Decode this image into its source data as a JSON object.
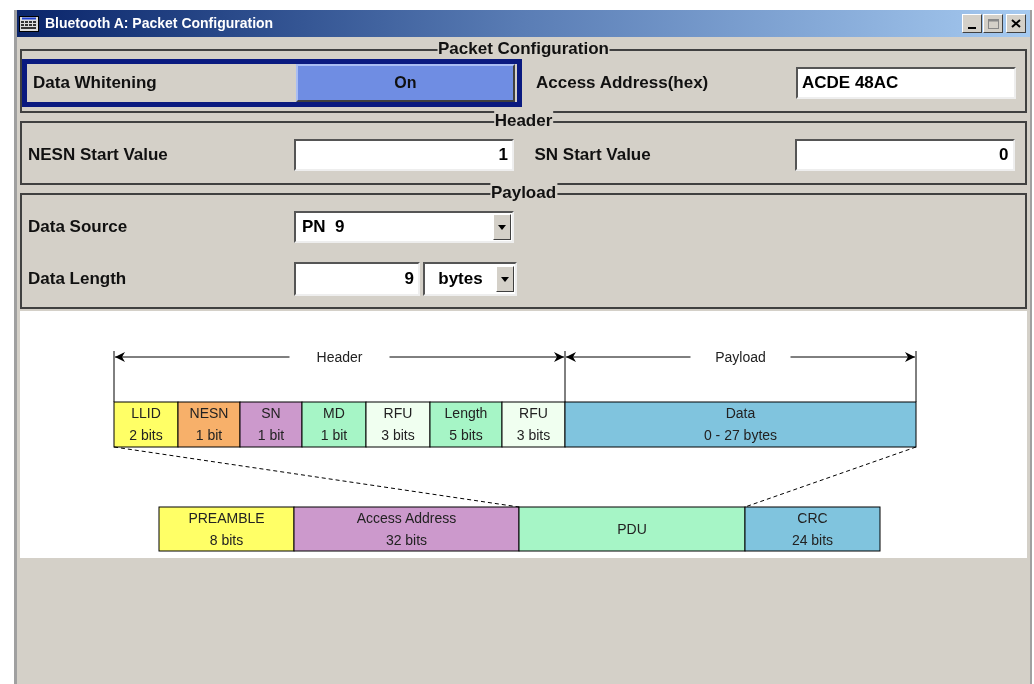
{
  "window": {
    "title": "Bluetooth A: Packet Configuration"
  },
  "sections": [
    {
      "title": "Packet Configuration",
      "rows": [
        [
          {
            "label": "Data Whitening",
            "kind": "toggle",
            "value": "On",
            "focused": true
          },
          {
            "label": "Access Address(hex)",
            "kind": "text",
            "value": "ACDE 48AC",
            "focused": false
          }
        ]
      ]
    },
    {
      "title": "Header",
      "rows": [
        [
          {
            "label": "NESN Start Value",
            "kind": "number",
            "value": "1",
            "focused": false
          },
          {
            "label": "SN Start Value",
            "kind": "number",
            "value": "0",
            "focused": false
          }
        ]
      ]
    },
    {
      "title": "Payload",
      "rows": [
        [
          {
            "label": "Data Source",
            "kind": "dropdown",
            "value": "PN  9",
            "focused": false
          }
        ],
        [
          {
            "label": "Data Length",
            "kind": "number_unit",
            "value": "9",
            "unit": "bytes",
            "focused": false
          }
        ]
      ]
    }
  ],
  "diagram": {
    "spans": [
      {
        "label": "Header"
      },
      {
        "label": "Payload"
      }
    ],
    "pdu_fields": [
      {
        "name": "LLID",
        "size": "2 bits",
        "color": "#ffff66"
      },
      {
        "name": "NESN",
        "size": "1 bit",
        "color": "#f7b06a"
      },
      {
        "name": "SN",
        "size": "1 bit",
        "color": "#cc99cc"
      },
      {
        "name": "MD",
        "size": "1 bit",
        "color": "#a6f5c6"
      },
      {
        "name": "RFU",
        "size": "3 bits",
        "color": "#f0fff0"
      },
      {
        "name": "Length",
        "size": "5 bits",
        "color": "#a6f5c6"
      },
      {
        "name": "RFU",
        "size": "3 bits",
        "color": "#f0fff0"
      },
      {
        "name": "Data",
        "size": "0 - 27 bytes",
        "color": "#80c4de"
      }
    ],
    "packet_fields": [
      {
        "name": "PREAMBLE",
        "size": "8 bits",
        "color": "#ffff66"
      },
      {
        "name": "Access Address",
        "size": "32 bits",
        "color": "#cc99cc"
      },
      {
        "name": "PDU",
        "color": "#a6f5c6"
      },
      {
        "name": "CRC",
        "size": "24 bits",
        "color": "#80c4de"
      }
    ]
  }
}
